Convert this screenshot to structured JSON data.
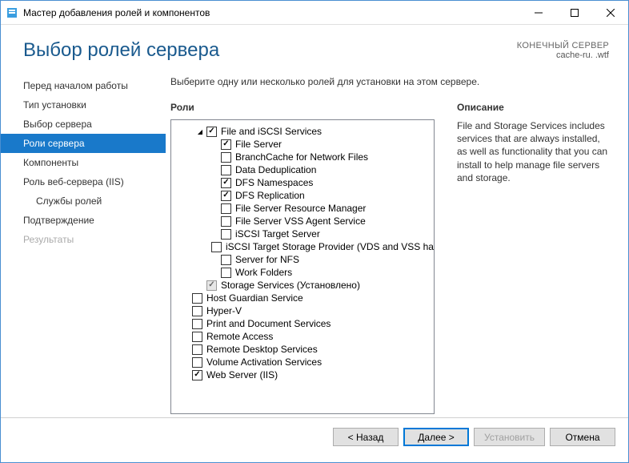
{
  "window": {
    "title": "Мастер добавления ролей и компонентов"
  },
  "header": {
    "page_title": "Выбор ролей сервера",
    "server_label": "КОНЕЧНЫЙ СЕРВЕР",
    "server_name": "cache-ru.            .wtf"
  },
  "sidebar": {
    "steps": [
      {
        "label": "Перед началом работы",
        "active": false,
        "sub": false,
        "disabled": false
      },
      {
        "label": "Тип установки",
        "active": false,
        "sub": false,
        "disabled": false
      },
      {
        "label": "Выбор сервера",
        "active": false,
        "sub": false,
        "disabled": false
      },
      {
        "label": "Роли сервера",
        "active": true,
        "sub": false,
        "disabled": false
      },
      {
        "label": "Компоненты",
        "active": false,
        "sub": false,
        "disabled": false
      },
      {
        "label": "Роль веб-сервера (IIS)",
        "active": false,
        "sub": false,
        "disabled": false
      },
      {
        "label": "Службы ролей",
        "active": false,
        "sub": true,
        "disabled": false
      },
      {
        "label": "Подтверждение",
        "active": false,
        "sub": false,
        "disabled": false
      },
      {
        "label": "Результаты",
        "active": false,
        "sub": false,
        "disabled": true
      }
    ]
  },
  "main": {
    "instruction": "Выберите одну или несколько ролей для установки на этом сервере.",
    "roles_header": "Роли",
    "desc_header": "Описание",
    "desc_text": "File and Storage Services includes services that are always installed, as well as functionality that you can install to help manage file servers and storage."
  },
  "tree": [
    {
      "indent": 1,
      "twisty": "open",
      "checked": true,
      "grey": false,
      "label": "File and iSCSI Services"
    },
    {
      "indent": 2,
      "twisty": "",
      "checked": true,
      "grey": false,
      "label": "File Server"
    },
    {
      "indent": 2,
      "twisty": "",
      "checked": false,
      "grey": false,
      "label": "BranchCache for Network Files"
    },
    {
      "indent": 2,
      "twisty": "",
      "checked": false,
      "grey": false,
      "label": "Data Deduplication"
    },
    {
      "indent": 2,
      "twisty": "",
      "checked": true,
      "grey": false,
      "label": "DFS Namespaces"
    },
    {
      "indent": 2,
      "twisty": "",
      "checked": true,
      "grey": false,
      "label": "DFS Replication"
    },
    {
      "indent": 2,
      "twisty": "",
      "checked": false,
      "grey": false,
      "label": "File Server Resource Manager"
    },
    {
      "indent": 2,
      "twisty": "",
      "checked": false,
      "grey": false,
      "label": "File Server VSS Agent Service"
    },
    {
      "indent": 2,
      "twisty": "",
      "checked": false,
      "grey": false,
      "label": "iSCSI Target Server"
    },
    {
      "indent": 2,
      "twisty": "",
      "checked": false,
      "grey": false,
      "label": "iSCSI Target Storage Provider (VDS and VSS hardware providers)"
    },
    {
      "indent": 2,
      "twisty": "",
      "checked": false,
      "grey": false,
      "label": "Server for NFS"
    },
    {
      "indent": 2,
      "twisty": "",
      "checked": false,
      "grey": false,
      "label": "Work Folders"
    },
    {
      "indent": 1,
      "twisty": "",
      "checked": true,
      "grey": true,
      "label": "Storage Services (Установлено)"
    },
    {
      "indent": 0,
      "twisty": "",
      "checked": false,
      "grey": false,
      "label": "Host Guardian Service"
    },
    {
      "indent": 0,
      "twisty": "",
      "checked": false,
      "grey": false,
      "label": "Hyper-V"
    },
    {
      "indent": 0,
      "twisty": "",
      "checked": false,
      "grey": false,
      "label": "Print and Document Services"
    },
    {
      "indent": 0,
      "twisty": "",
      "checked": false,
      "grey": false,
      "label": "Remote Access"
    },
    {
      "indent": 0,
      "twisty": "",
      "checked": false,
      "grey": false,
      "label": "Remote Desktop Services"
    },
    {
      "indent": 0,
      "twisty": "",
      "checked": false,
      "grey": false,
      "label": "Volume Activation Services"
    },
    {
      "indent": 0,
      "twisty": "",
      "checked": true,
      "grey": false,
      "label": "Web Server (IIS)"
    }
  ],
  "buttons": {
    "previous": "< Назад",
    "next": "Далее >",
    "install": "Установить",
    "cancel": "Отмена"
  }
}
